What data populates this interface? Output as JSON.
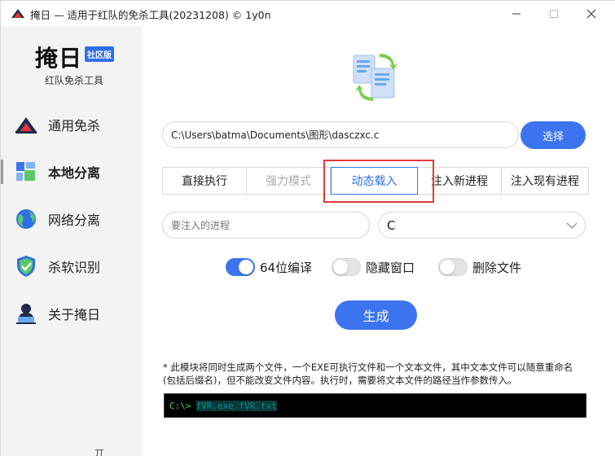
{
  "window": {
    "title": "掩日 — 适用于红队的免杀工具(20231208) © 1y0n",
    "minimize_icon": "minimize-icon",
    "maximize_icon": "maximize-icon",
    "close_icon": "close-icon"
  },
  "sidebar": {
    "logo_title": "掩日",
    "logo_badge": "社区版",
    "logo_subtitle": "红队免杀工具",
    "items": [
      {
        "label": "通用免杀",
        "icon": "house-shield-icon",
        "active": false
      },
      {
        "label": "本地分离",
        "icon": "split-blocks-icon",
        "active": true
      },
      {
        "label": "网络分离",
        "icon": "globe-icon",
        "active": false
      },
      {
        "label": "杀软识别",
        "icon": "shield-check-icon",
        "active": false
      },
      {
        "label": "关于掩日",
        "icon": "user-laptop-icon",
        "active": false
      }
    ]
  },
  "main": {
    "file_path": "C:\\Users\\batma\\Documents\\图形\\dasczxc.c",
    "select_label": "选择",
    "tabs": [
      {
        "label": "直接执行",
        "state": "normal"
      },
      {
        "label": "强力模式",
        "state": "disabled"
      },
      {
        "label": "动态载入",
        "state": "active"
      },
      {
        "label": "注入新进程",
        "state": "normal"
      },
      {
        "label": "注入现有进程",
        "state": "normal"
      }
    ],
    "process_placeholder": "要注入的进程",
    "language_value": "C",
    "toggles": [
      {
        "label": "64位编译",
        "on": true
      },
      {
        "label": "隐藏窗口",
        "on": false
      },
      {
        "label": "删除文件",
        "on": false
      }
    ],
    "generate_label": "生成",
    "note_line1": "* 此模块将同时生成两个文件，一个EXE可执行文件和一个文本文件，其中文本文件可以随意重命名",
    "note_line2": "(包括后缀名)，但不能改变文件内容。执行时，需要将文本文件的路径当作参数传入。",
    "terminal_prompt": "C:\\>",
    "terminal_command": "fVR.exe fVR.txt"
  },
  "colors": {
    "accent": "#3b74ee",
    "highlight": "#e03b3b",
    "terminal_bg": "#000000"
  },
  "taskbar_glyph": "丌"
}
